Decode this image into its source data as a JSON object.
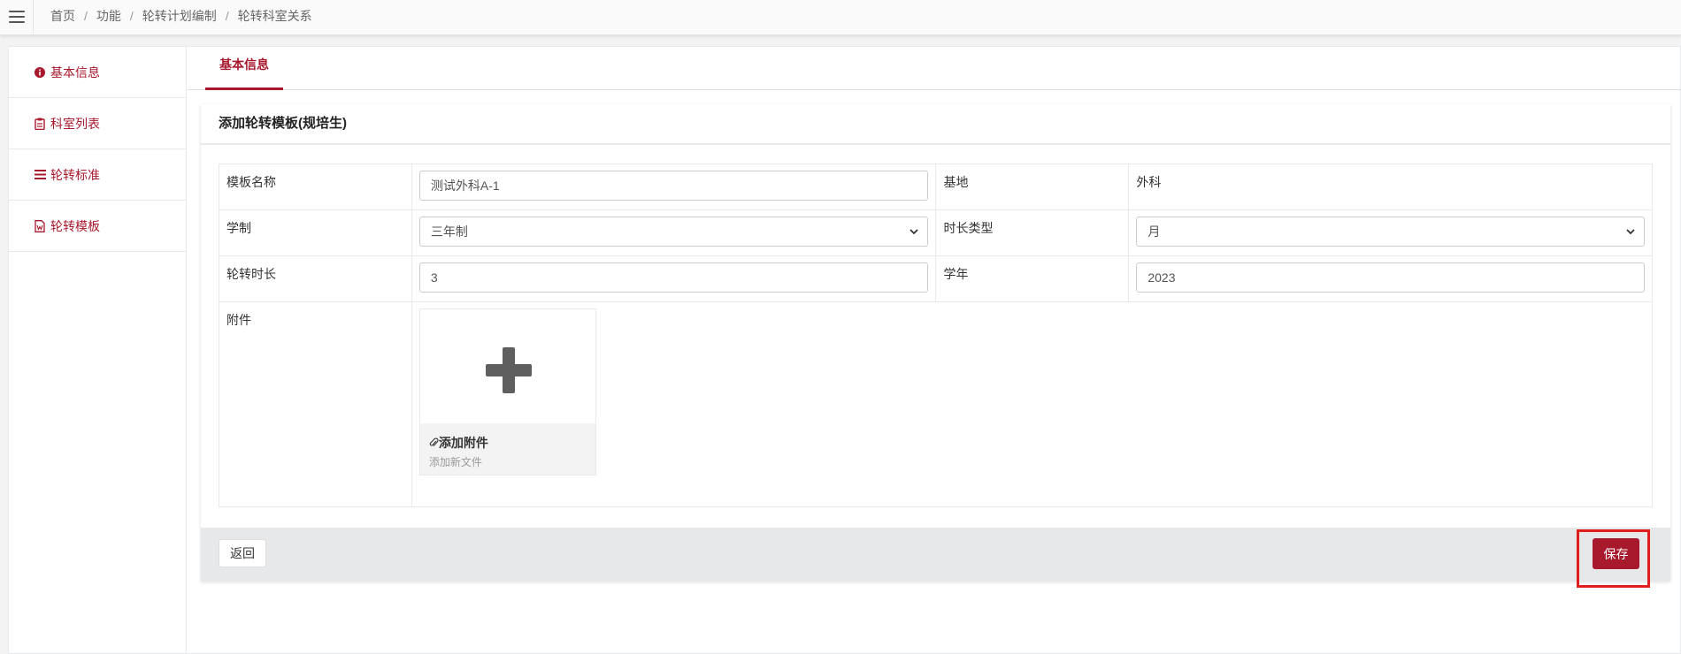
{
  "header": {
    "menu_icon": "hamburger-icon",
    "breadcrumb": [
      "首页",
      "功能",
      "轮转计划编制",
      "轮转科室关系"
    ],
    "separator": "/"
  },
  "sidebar": {
    "items": [
      {
        "label": "基本信息",
        "icon": "info-circle-icon"
      },
      {
        "label": "科室列表",
        "icon": "clipboard-icon"
      },
      {
        "label": "轮转标准",
        "icon": "list-icon"
      },
      {
        "label": "轮转模板",
        "icon": "document-icon"
      }
    ]
  },
  "tabs": {
    "active": "基本信息"
  },
  "form": {
    "title": "添加轮转模板(规培生)",
    "template_name_label": "模板名称",
    "template_name_value": "测试外科A-1",
    "base_label": "基地",
    "base_value": "外科",
    "school_system_label": "学制",
    "school_system_value": "三年制",
    "duration_type_label": "时长类型",
    "duration_type_value": "月",
    "rotation_duration_label": "轮转时长",
    "rotation_duration_value": "3",
    "academic_year_label": "学年",
    "academic_year_value": "2023",
    "attachment_label": "附件",
    "upload_title": "添加附件",
    "upload_subtitle": "添加新文件"
  },
  "footer": {
    "back_label": "返回",
    "save_label": "保存"
  },
  "colors": {
    "accent": "#a8192e",
    "highlight_box": "#e11d1d",
    "footer_bg": "#e7e8ea"
  }
}
